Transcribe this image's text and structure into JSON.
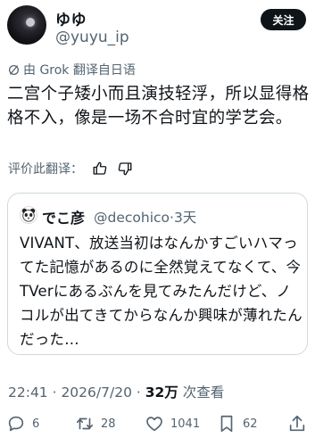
{
  "author": {
    "display_name": "ゆゆ",
    "handle": "@yuyu_ip",
    "follow_label": "关注"
  },
  "translation_note": "由 Grok 翻译自日语",
  "tweet_text": "二宫个子矮小而且演技轻浮，所以显得格格不入，像是一场不合时宜的学艺会。",
  "rate_translation_label": "评价此翻译：",
  "quote": {
    "display_name": "でこ彦",
    "handle_time": "@decohico·3天",
    "text": "VIVANT、放送当初はなんかすごいハマってた記憶があるのに全然覚えてなくて、今TVerにあるぶんを見てみたんだけど、ノコルが出てきてからなんか興味が薄れたんだった…"
  },
  "meta": {
    "time_date": "22:41 · 2026/7/20 · ",
    "views": "32万",
    "views_suffix": " 次查看"
  },
  "actions": {
    "replies": "6",
    "retweets": "28",
    "likes": "1041",
    "bookmarks": "62"
  }
}
